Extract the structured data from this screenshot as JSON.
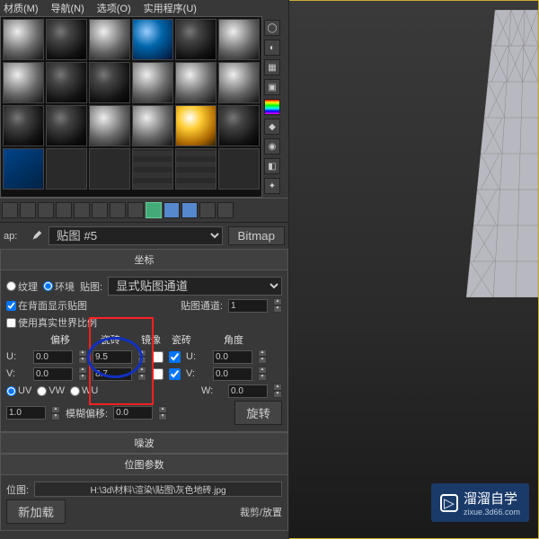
{
  "menu": {
    "material": "材质(M)",
    "nav": "导航(N)",
    "options": "选项(O)",
    "utilities": "实用程序(U)"
  },
  "map_row": {
    "label": "ap:",
    "map_name": "贴图 #5",
    "map_type": "Bitmap"
  },
  "rollups": {
    "coords": "坐标",
    "noise": "噪波",
    "bitmap": "位图参数"
  },
  "coords": {
    "texture": "纹理",
    "env": "环境",
    "maptex": "贴图:",
    "map_mode": "显式贴图通道",
    "backface": "在背面显示贴图",
    "channel_label": "贴图通道:",
    "channel": "1",
    "realworld": "使用真实世界比例",
    "offset": "偏移",
    "tiling": "瓷砖",
    "mirror": "镜像",
    "tile": "瓷砖",
    "angle": "角度",
    "u": "U:",
    "v": "V:",
    "w": "W:",
    "u_off": "0.0",
    "v_off": "0.0",
    "u_tile": "9.5",
    "v_tile": "8.7",
    "u_ang": "0.0",
    "v_ang": "0.0",
    "w_ang": "0.0",
    "uv": "UV",
    "vw": "VW",
    "wu": "WU",
    "blur": "1.0",
    "blur_off_label": "模糊偏移:",
    "blur_off": "0.0",
    "rotate": "旋转"
  },
  "bitmap": {
    "path_label": "位图:",
    "path": "H:\\3d\\材料\\渲染\\贴图\\灰色地砖.jpg",
    "reload": "新加载",
    "crop": "裁剪/放置"
  },
  "watermark": {
    "title": "溜溜自学",
    "sub": "zixue.3d66.com"
  }
}
